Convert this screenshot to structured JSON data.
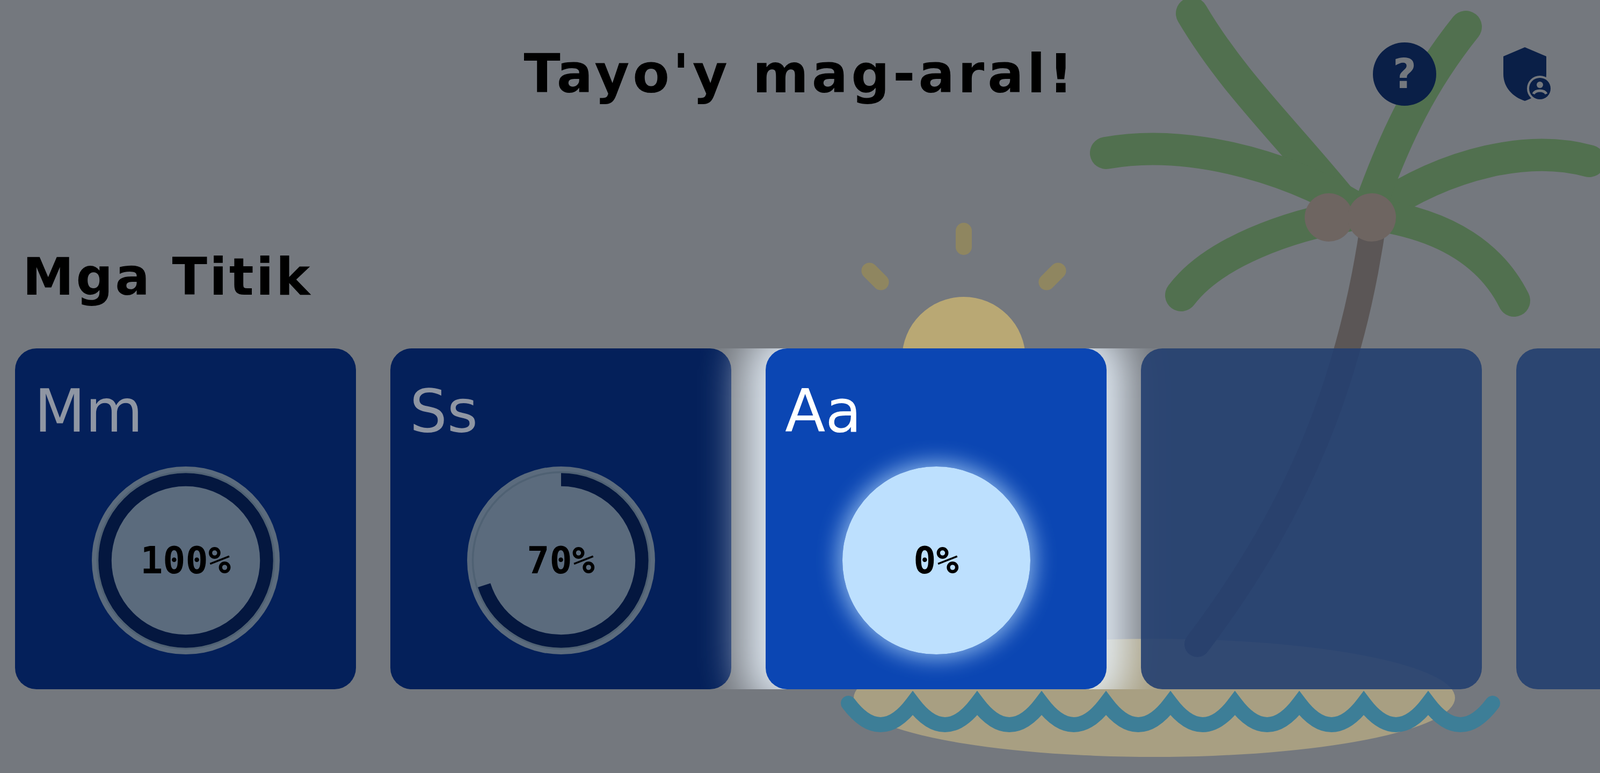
{
  "header": {
    "title": "Tayo'y mag-aral!",
    "help_icon": "?"
  },
  "section": {
    "title": "Mga Titik"
  },
  "cards": [
    {
      "kind": "letter",
      "letter": "Mm",
      "percent": "100%",
      "level": 1,
      "highlighted": false
    },
    {
      "kind": "letter",
      "letter": "Ss",
      "percent": "70%",
      "level": 0.7,
      "highlighted": false
    },
    {
      "kind": "letter",
      "letter": "Aa",
      "percent": "0%",
      "level": 0,
      "highlighted": true
    },
    {
      "kind": "empty",
      "highlighted": false
    },
    {
      "kind": "empty",
      "highlighted": false
    }
  ]
}
